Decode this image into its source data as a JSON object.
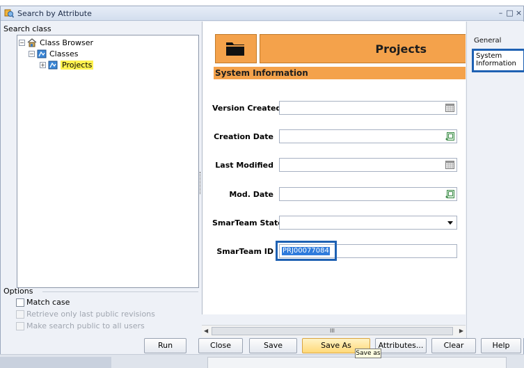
{
  "window": {
    "title": "Search by Attribute",
    "controls": [
      "–",
      "□",
      "×"
    ]
  },
  "left_panel": {
    "search_label": "Search class",
    "tree": [
      {
        "label": "Class Browser",
        "expander": "−",
        "icon": "class-browser-icon"
      },
      {
        "label": "Classes",
        "expander": "−",
        "icon": "classes-icon"
      },
      {
        "label": "Projects",
        "expander": "+",
        "icon": "projects-icon",
        "selected": true
      }
    ],
    "options": {
      "title": "Options",
      "items": [
        {
          "label": "Match case",
          "enabled": true,
          "checked": false
        },
        {
          "label": "Retrieve only last public revisions",
          "enabled": false,
          "checked": false
        },
        {
          "label": "Make search public to all users",
          "enabled": false,
          "checked": false
        }
      ]
    }
  },
  "form": {
    "class_name": "Projects",
    "section": "System Information",
    "fields": [
      {
        "label": "Version Created",
        "value": "",
        "control": "calendar-icon"
      },
      {
        "label": "Creation Date",
        "value": "",
        "control": "date-picker-icon"
      },
      {
        "label": "Last Modified",
        "value": "",
        "control": "calendar-icon"
      },
      {
        "label": "Mod. Date",
        "value": "",
        "control": "date-picker-icon"
      },
      {
        "label": "SmarTeam State",
        "value": "",
        "control": "dropdown"
      },
      {
        "label": "SmarTeam ID",
        "value": "PRJ00077084",
        "control": "none"
      }
    ],
    "scroll_thumb": "III"
  },
  "tabs": [
    {
      "label": "General"
    },
    {
      "label_line1": "System",
      "label_line2": "Information",
      "active": true
    }
  ],
  "buttons": [
    {
      "label": "Run"
    },
    {
      "label": "Close"
    },
    {
      "label": "Save"
    },
    {
      "label": "Save As",
      "active": true
    },
    {
      "label": "Attributes..."
    },
    {
      "label": "Clear"
    },
    {
      "label": "Help"
    }
  ],
  "tooltip": "Save as",
  "colors": {
    "accent_orange": "#f4a24b",
    "highlight_blue": "#1e61b3",
    "selection_yellow": "#fff24f"
  }
}
